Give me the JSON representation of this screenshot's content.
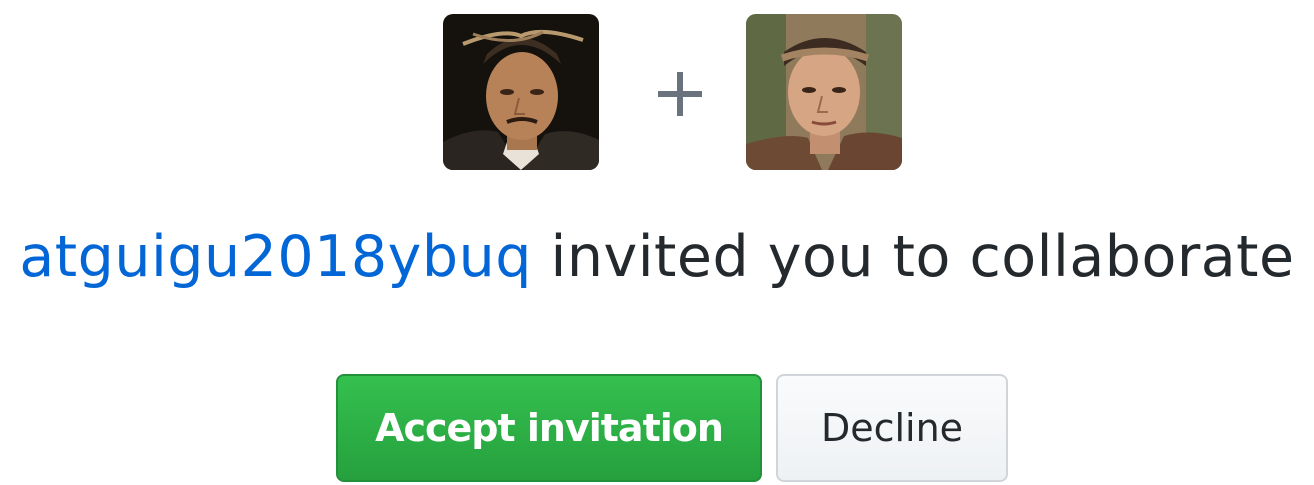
{
  "invitation": {
    "inviter_username": "atguigu2018ybuq",
    "message": " invited you to collaborate",
    "inviter_avatar_alt": "atguigu2018ybuq avatar",
    "invitee_avatar_alt": "your avatar"
  },
  "actions": {
    "accept_label": "Accept invitation",
    "decline_label": "Decline"
  },
  "icons": {
    "separator": "plus-icon"
  },
  "colors": {
    "link": "#0366d6",
    "text": "#24292e",
    "accept_button": "#28a745",
    "decline_button": "#fafbfc",
    "separator_icon": "#6a737d"
  }
}
